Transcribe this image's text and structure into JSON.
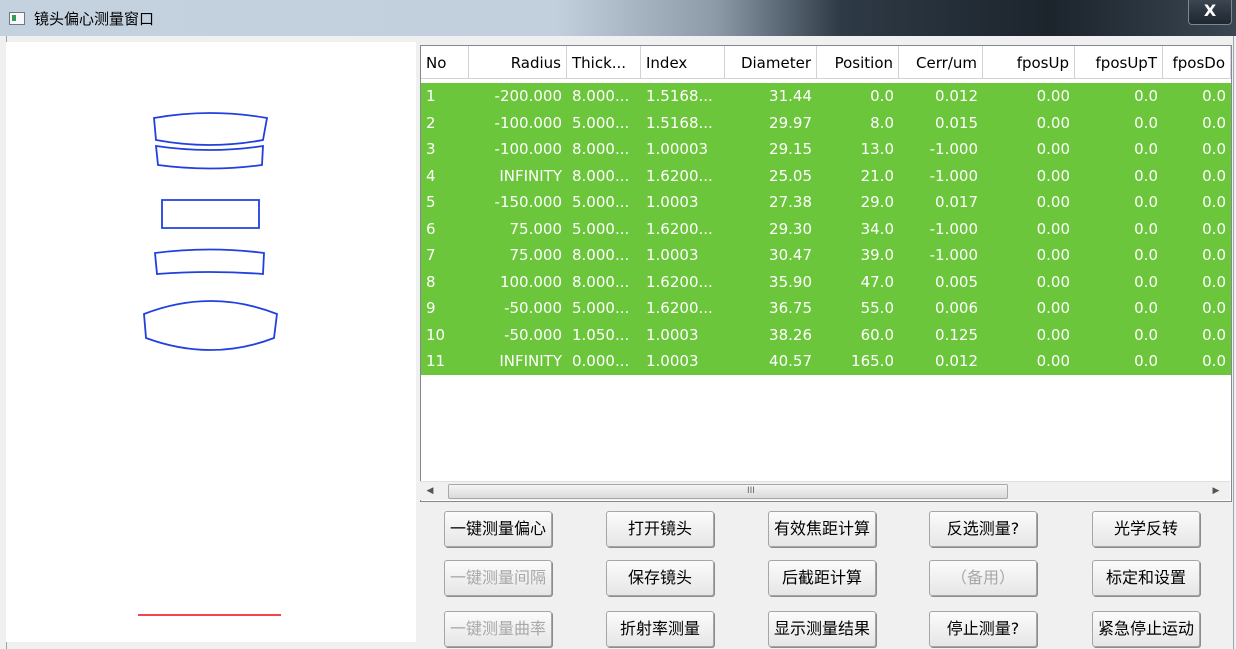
{
  "window": {
    "title": "镜头偏心测量窗口",
    "close_label": "X"
  },
  "table": {
    "columns": [
      "No",
      "Radius",
      "Thick...",
      "Index",
      "Diameter",
      "Position",
      "Cerr/um",
      "fposUp",
      "fposUpT",
      "fposDo"
    ],
    "rows": [
      [
        "1",
        "-200.000",
        "8.000...",
        "1.5168...",
        "31.44",
        "0.0",
        "0.012",
        "0.00",
        "0.0",
        "0.0"
      ],
      [
        "2",
        "-100.000",
        "5.000...",
        "1.5168...",
        "29.97",
        "8.0",
        "0.015",
        "0.00",
        "0.0",
        "0.0"
      ],
      [
        "3",
        "-100.000",
        "8.000...",
        "1.00003",
        "29.15",
        "13.0",
        "-1.000",
        "0.00",
        "0.0",
        "0.0"
      ],
      [
        "4",
        "INFINITY",
        "8.000...",
        "1.6200...",
        "25.05",
        "21.0",
        "-1.000",
        "0.00",
        "0.0",
        "0.0"
      ],
      [
        "5",
        "-150.000",
        "5.000...",
        "1.0003",
        "27.38",
        "29.0",
        "0.017",
        "0.00",
        "0.0",
        "0.0"
      ],
      [
        "6",
        "75.000",
        "5.000...",
        "1.6200...",
        "29.30",
        "34.0",
        "-1.000",
        "0.00",
        "0.0",
        "0.0"
      ],
      [
        "7",
        "75.000",
        "8.000...",
        "1.0003",
        "30.47",
        "39.0",
        "-1.000",
        "0.00",
        "0.0",
        "0.0"
      ],
      [
        "8",
        "100.000",
        "8.000...",
        "1.6200...",
        "35.90",
        "47.0",
        "0.005",
        "0.00",
        "0.0",
        "0.0"
      ],
      [
        "9",
        "-50.000",
        "5.000...",
        "1.6200...",
        "36.75",
        "55.0",
        "0.006",
        "0.00",
        "0.0",
        "0.0"
      ],
      [
        "10",
        "-50.000",
        "1.050...",
        "1.0003",
        "38.26",
        "60.0",
        "0.125",
        "0.00",
        "0.0",
        "0.0"
      ],
      [
        "11",
        "INFINITY",
        "0.000...",
        "1.0003",
        "40.57",
        "165.0",
        "0.012",
        "0.00",
        "0.0",
        "0.0"
      ]
    ],
    "selected_row_color": "#6cc63c",
    "scroll_grip": "III"
  },
  "buttons": [
    {
      "label": "一键测量偏心",
      "enabled": true
    },
    {
      "label": "打开镜头",
      "enabled": true
    },
    {
      "label": "有效焦距计算",
      "enabled": true
    },
    {
      "label": "反选测量?",
      "enabled": true
    },
    {
      "label": "光学反转",
      "enabled": true
    },
    {
      "label": "一键测量间隔",
      "enabled": false
    },
    {
      "label": "保存镜头",
      "enabled": true
    },
    {
      "label": "后截距计算",
      "enabled": true
    },
    {
      "label": "（备用）",
      "enabled": false
    },
    {
      "label": "标定和设置",
      "enabled": true
    },
    {
      "label": "一键测量曲率",
      "enabled": false
    },
    {
      "label": "折射率测量",
      "enabled": true
    },
    {
      "label": "显示测量结果",
      "enabled": true
    },
    {
      "label": "停止测量?",
      "enabled": true
    },
    {
      "label": "紧急停止运动",
      "enabled": true
    }
  ],
  "colors": {
    "lens_outline": "#2040e0",
    "indicator_line": "#f04848",
    "title_text": "#000000"
  }
}
